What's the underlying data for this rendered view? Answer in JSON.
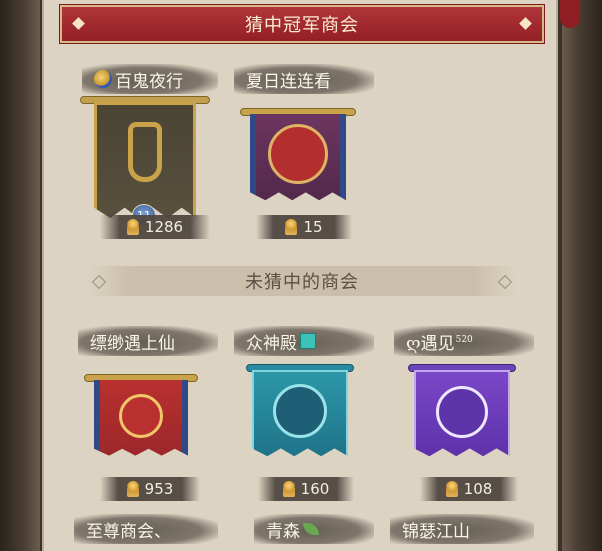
{
  "header": {
    "title": "猜中冠军商会"
  },
  "winners": [
    {
      "name": "百鬼夜行",
      "count": "1286",
      "badge": "11"
    },
    {
      "name": "夏日连连看",
      "count": "15"
    }
  ],
  "section_title": "未猜中的商会",
  "others": [
    {
      "name": "缥缈遇上仙",
      "count": "953"
    },
    {
      "name": "众神殿",
      "count": "160"
    },
    {
      "name": "ღ遇见",
      "sup": "520",
      "count": "108"
    }
  ],
  "bottom_row": [
    {
      "name": "至尊商会、"
    },
    {
      "name": "青森"
    },
    {
      "name": "锦瑟江山"
    }
  ],
  "colors": {
    "title_red": "#a3282d",
    "panel": "#dcd3c2",
    "label_bg": "#5f584e"
  }
}
